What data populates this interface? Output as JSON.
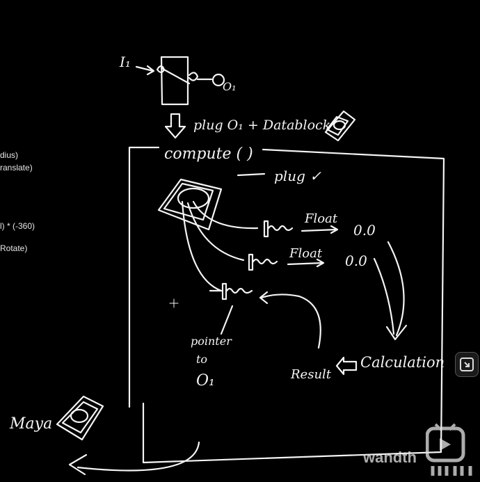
{
  "video_overlay": {
    "left_text_1": "dius)",
    "left_text_2": "ranslate)",
    "left_text_3": "l) * (-360)",
    "left_text_4": "Rotate)",
    "watermark_text": "wandth",
    "bili_logo": "bilibili-logo-icon",
    "expand_icon": "expand-icon"
  },
  "diagram": {
    "input_label": "I₁",
    "output_label": "O₁",
    "plug_line": "plug O₁ + Datablock",
    "compute_label": "compute ( )",
    "plug_check": "plug ✓",
    "float_label_1": "Float",
    "float_label_2": "Float",
    "value_1": "0.0",
    "value_2": "0.0",
    "pointer_line_1": "pointer",
    "pointer_line_2": "to",
    "pointer_line_3": "O₁",
    "result_label": "Result",
    "calculation_label": "Calculation",
    "maya_label": "Maya"
  },
  "colors": {
    "background": "#000000",
    "ink": "#f4f4f4"
  }
}
